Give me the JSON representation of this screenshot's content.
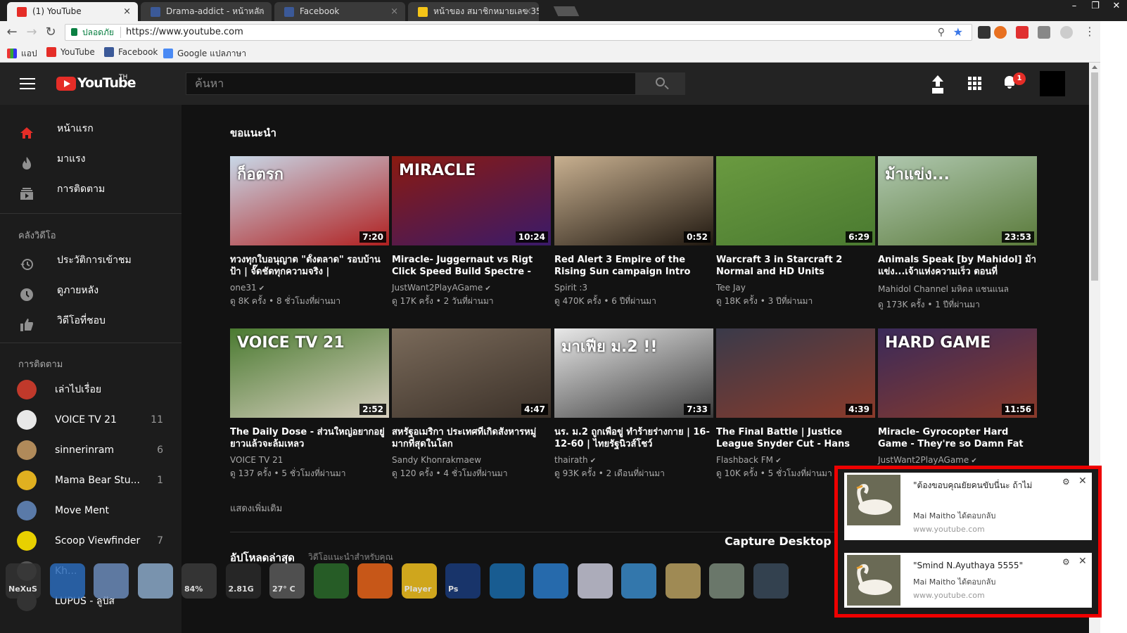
{
  "browser": {
    "tabs": [
      {
        "title": "(1) YouTube",
        "favicon_color": "#e52d27"
      },
      {
        "title": "Drama-addict - หน้าหลัก",
        "favicon_color": "#3b5998"
      },
      {
        "title": "Facebook",
        "favicon_color": "#3b5998"
      },
      {
        "title": "หน้าของ สมาชิกหมายเลข 35",
        "favicon_color": "#f5c518"
      }
    ],
    "close_glyph": "×",
    "window_buttons": [
      "–",
      "❐",
      "✕"
    ],
    "secure_label": "ปลอดภัย",
    "url": "https://www.youtube.com",
    "bookmarks": [
      {
        "label": "แอป",
        "icon": "apps-grid-icon"
      },
      {
        "label": "YouTube",
        "icon": "youtube-icon"
      },
      {
        "label": "Facebook",
        "icon": "facebook-icon"
      },
      {
        "label": "Google แปลภาษา",
        "icon": "google-translate-icon"
      }
    ]
  },
  "youtube": {
    "logo_text": "YouTube",
    "country_code": "TH",
    "search_placeholder": "ค้นหา",
    "notification_count": "1",
    "sidebar": {
      "main": [
        {
          "label": "หน้าแรก",
          "icon": "home-icon"
        },
        {
          "label": "มาแรง",
          "icon": "trending-flame-icon"
        },
        {
          "label": "การติดตาม",
          "icon": "subscriptions-icon"
        }
      ],
      "library_header": "คลังวิดีโอ",
      "library": [
        {
          "label": "ประวัติการเข้าชม",
          "icon": "history-icon"
        },
        {
          "label": "ดูภายหลัง",
          "icon": "watch-later-clock-icon"
        },
        {
          "label": "วิดีโอที่ชอบ",
          "icon": "thumbs-up-icon"
        }
      ],
      "subscriptions_header": "การติดตาม",
      "subscriptions": [
        {
          "name": "เล่าไปเรื่อย",
          "count": "",
          "color": "#c0392b"
        },
        {
          "name": "VOICE TV 21",
          "count": "11",
          "color": "#e8e8e8"
        },
        {
          "name": "sinnerinram",
          "count": "6",
          "color": "#b08a5a"
        },
        {
          "name": "Mama Bear Stu...",
          "count": "1",
          "color": "#e0b020"
        },
        {
          "name": "Move Ment",
          "count": "",
          "color": "#5a7aa8"
        },
        {
          "name": "Scoop Viewfinder",
          "count": "7",
          "color": "#e8d000"
        },
        {
          "name": "Kh...",
          "count": "",
          "color": "#555555"
        },
        {
          "name": "LUPUS - ลูปัส",
          "count": "",
          "color": "#333333"
        }
      ]
    },
    "section_title": "ขอแนะนำ",
    "videos": [
      {
        "title": "ทวงทุกใบอนุญาต \"ตั้งตลาด\" รอบบ้านป้า | จั๊ดชัดทุกความจริง |",
        "channel": "one31",
        "verified": true,
        "meta": "ดู 8K ครั้ง • 8 ชั่วโมงที่ผ่านมา",
        "duration": "7:20",
        "thumb_top": "#c8d8e8",
        "thumb_bottom": "#b02020",
        "overlay": "ก็อตรก"
      },
      {
        "title": "Miracle- Juggernaut vs Rigt Click Speed Build Spectre -",
        "channel": "JustWant2PlayAGame",
        "verified": true,
        "meta": "ดู 17K ครั้ง • 2 วันที่ผ่านมา",
        "duration": "10:24",
        "thumb_top": "#8a1a10",
        "thumb_bottom": "#3a1a6a",
        "overlay": "MIRACLE"
      },
      {
        "title": "Red Alert 3 Empire of the Rising Sun campaign Intro",
        "channel": "Spirit :3",
        "verified": false,
        "meta": "ดู 470K ครั้ง • 6 ปีที่ผ่านมา",
        "duration": "0:52",
        "thumb_top": "#c8b090",
        "thumb_bottom": "#201810",
        "overlay": ""
      },
      {
        "title": "Warcraft 3 in Starcraft 2 Normal and HD Units",
        "channel": "Tee Jay",
        "verified": false,
        "meta": "ดู 18K ครั้ง • 3 ปีที่ผ่านมา",
        "duration": "6:29",
        "thumb_top": "#6a9a40",
        "thumb_bottom": "#4a7a30",
        "overlay": ""
      },
      {
        "title": "Animals Speak [by Mahidol] ม้าแข่ง...เจ้าแห่งความเร็ว ตอนที่",
        "channel": "Mahidol Channel มหิดล แชนแนล",
        "verified": false,
        "meta": "ดู 173K ครั้ง • 1 ปีที่ผ่านมา",
        "duration": "23:53",
        "thumb_top": "#b0c8b0",
        "thumb_bottom": "#5a7a3a",
        "overlay": "ม้าแข่ง..."
      },
      {
        "title": "The Daily Dose - ส่วนใหญ่อยากอยู่ยาวแล้วจะล้มเหลว",
        "channel": "VOICE TV 21",
        "verified": false,
        "meta": "ดู 137 ครั้ง • 5 ชั่วโมงที่ผ่านมา",
        "duration": "2:52",
        "thumb_top": "#4a7a30",
        "thumb_bottom": "#d8d0c0",
        "overlay": "VOICE TV 21"
      },
      {
        "title": "สหรัฐอเมริกา ประเทศที่เกิดสังหารหมู่มากที่สุดในโลก",
        "channel": "Sandy Khonrakmaew",
        "verified": false,
        "meta": "ดู 120 ครั้ง • 4 ชั่วโมงที่ผ่านมา",
        "duration": "4:47",
        "thumb_top": "#7a6a5a",
        "thumb_bottom": "#3a3028",
        "overlay": ""
      },
      {
        "title": "นร. ม.2 ถูกเพื่อขู่ ทำร้ายร่างกาย | 16-12-60 | ไทยรัฐนิวส์โชว์",
        "channel": "thairath",
        "verified": true,
        "meta": "ดู 93K ครั้ง • 2 เดือนที่ผ่านมา",
        "duration": "7:33",
        "thumb_top": "#e8e8e8",
        "thumb_bottom": "#3a3a3a",
        "overlay": "มาเฟีย ม.2 !!"
      },
      {
        "title": "The Final Battle | Justice League Snyder Cut - Hans",
        "channel": "Flashback FM",
        "verified": true,
        "meta": "ดู 10K ครั้ง • 5 ชั่วโมงที่ผ่านมา",
        "duration": "4:39",
        "thumb_top": "#3a3a4a",
        "thumb_bottom": "#8a3a2a",
        "overlay": ""
      },
      {
        "title": "Miracle- Gyrocopter Hard Game - They're so Damn Fat",
        "channel": "JustWant2PlayAGame",
        "verified": true,
        "meta": "",
        "duration": "11:56",
        "thumb_top": "#3a2a5a",
        "thumb_bottom": "#8a3a2a",
        "overlay": "HARD GAME"
      }
    ],
    "show_more": "แสดงเพิ่มเติม",
    "uploads_title": "อัปโหลดล่าสุด",
    "uploads_subtitle": "วิดีโอแนะนำสำหรับคุณ"
  },
  "desktop": {
    "capture_label": "Capture Desktop",
    "dock": [
      {
        "icon": "nexus-logo-icon",
        "color": "#333333",
        "label": "NeXuS"
      },
      {
        "icon": "windows-logo-icon",
        "color": "#2a6ab8",
        "label": ""
      },
      {
        "icon": "computer-icon",
        "color": "#6a8ab8",
        "label": ""
      },
      {
        "icon": "recycle-bin-icon",
        "color": "#8aa8c8",
        "label": ""
      },
      {
        "icon": "cpu-meter-icon",
        "color": "#3a3a3a",
        "label": "84%"
      },
      {
        "icon": "memory-meter-icon",
        "color": "#2a2a2a",
        "label": "2.81G"
      },
      {
        "icon": "weather-moon-icon",
        "color": "#5a5a5a",
        "label": "27° C"
      },
      {
        "icon": "shuffle-icon",
        "color": "#2a6a2a",
        "label": ""
      },
      {
        "icon": "firefox-icon",
        "color": "#e8641a",
        "label": ""
      },
      {
        "icon": "player-icon",
        "color": "#f0c020",
        "label": "Player"
      },
      {
        "icon": "photoshop-icon",
        "color": "#1a3a7a",
        "label": "Ps"
      },
      {
        "icon": "camera-lens-icon",
        "color": "#1a6aa8",
        "label": ""
      },
      {
        "icon": "bug-shield-icon",
        "color": "#2a7ac8",
        "label": ""
      },
      {
        "icon": "disk-utility-icon",
        "color": "#c8c8d8",
        "label": ""
      },
      {
        "icon": "flash-tool-icon",
        "color": "#3a8ac8",
        "label": ""
      },
      {
        "icon": "atom-globe-icon",
        "color": "#b8a060",
        "label": ""
      },
      {
        "icon": "eye-drive-icon",
        "color": "#7a8a7a",
        "label": ""
      },
      {
        "icon": "webcam-icon",
        "color": "#3a4a5a",
        "label": ""
      }
    ]
  },
  "notifications": [
    {
      "text": "\"ต้องขอบคุณยัยคนขับนี่นะ ถ้าไม่",
      "source": "Mai Maitho ได้ตอบกลับ",
      "url": "www.youtube.com"
    },
    {
      "text": "\"Smind N.Ayuthaya 5555\"",
      "source": "Mai Maitho ได้ตอบกลับ",
      "url": "www.youtube.com"
    }
  ],
  "notification_glyphs": {
    "settings": "⚙",
    "close": "✕"
  }
}
